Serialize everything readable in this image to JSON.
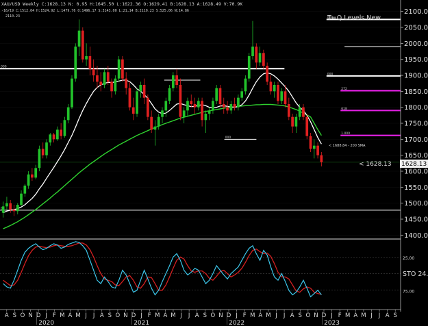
{
  "header": {
    "line1": "XAU/USD Weekly C:1628.13 N: 0.95 H:1645.50 L:1622.36 O:1629.41 B:1628.13 A:1628.49 V:70.9K",
    "line2": "-16/19 C:1512.04 H:1524.92 L:1479.76 O:1496.17 S:3143.00 L:21,14 B:2110.23 S:525.06 N:14.86",
    "line3": "2110.23"
  },
  "title": "T=Q Levels New",
  "colors": {
    "background": "#000000",
    "up": "#22c22b",
    "down": "#e02020",
    "sma200": "#2fd12f",
    "smaFast": "#ffffff",
    "smaSlow": "#bdbdbd",
    "level": "#ffffff",
    "magenta": "#e020e0",
    "stoK": "#3cc6ea",
    "stoD": "#d42020"
  },
  "chart_data": {
    "type": "line",
    "title": "T=Q Levels New",
    "price_axis": {
      "ylim": [
        1390,
        2110
      ],
      "ticks": [
        1400,
        1450,
        1500,
        1550,
        1600,
        1650,
        1700,
        1750,
        1800,
        1850,
        1900,
        1950,
        2000,
        2050,
        2100
      ]
    },
    "current_price": {
      "value": 1628.13,
      "label": "< 1628.13",
      "box": "1628.13"
    },
    "sma_note": "< 1688.84 - 200 SMA",
    "months": [
      "A",
      "S",
      "O",
      "N",
      "D",
      "J",
      "F",
      "M",
      "A",
      "M",
      "J",
      "J",
      "A",
      "S",
      "O",
      "N",
      "D",
      "J",
      "F",
      "M",
      "A",
      "M",
      "J",
      "J",
      "A",
      "S",
      "O",
      "N",
      "D",
      "J",
      "F",
      "M",
      "A",
      "M",
      "J",
      "J",
      "A",
      "S",
      "O",
      "N",
      "D",
      "J",
      "F",
      "M",
      "A",
      "M",
      "J",
      "J",
      "A",
      "S"
    ],
    "years": [
      "2020",
      "2021",
      "2022",
      "2023"
    ],
    "horizontal_levels": [
      {
        "value": 1921,
        "from": 0.0,
        "to": 0.71,
        "color": "level",
        "label": "000"
      },
      {
        "value": 1478,
        "from": 0.0,
        "to": 1.0,
        "color": "level",
        "label": "0"
      },
      {
        "value": 2075,
        "from": 0.815,
        "to": 1.0,
        "color": "level",
        "label": "000"
      },
      {
        "value": 1898,
        "from": 0.815,
        "to": 1.0,
        "color": "level",
        "label": "000"
      },
      {
        "value": 1990,
        "from": 0.86,
        "to": 1.0,
        "color": "level",
        "label": ""
      },
      {
        "value": 1712,
        "from": 0.85,
        "to": 1.0,
        "color": "magenta",
        "label": "1.000"
      },
      {
        "value": 1852,
        "from": 0.85,
        "to": 1.0,
        "color": "magenta",
        "label": "272"
      },
      {
        "value": 1790,
        "from": 0.85,
        "to": 1.0,
        "color": "magenta",
        "label": "618"
      },
      {
        "value": 1885,
        "from": 0.41,
        "to": 0.5,
        "color": "level",
        "label": ""
      },
      {
        "value": 1700,
        "from": 0.56,
        "to": 0.64,
        "color": "level",
        "label": "000"
      }
    ],
    "candles": [
      [
        1470,
        1505,
        1455,
        1490
      ],
      [
        1490,
        1520,
        1480,
        1500
      ],
      [
        1500,
        1510,
        1470,
        1480
      ],
      [
        1480,
        1495,
        1460,
        1475
      ],
      [
        1475,
        1500,
        1465,
        1495
      ],
      [
        1495,
        1540,
        1490,
        1530
      ],
      [
        1530,
        1560,
        1520,
        1555
      ],
      [
        1555,
        1600,
        1545,
        1590
      ],
      [
        1590,
        1610,
        1570,
        1580
      ],
      [
        1580,
        1620,
        1575,
        1610
      ],
      [
        1610,
        1680,
        1600,
        1670
      ],
      [
        1670,
        1690,
        1640,
        1650
      ],
      [
        1650,
        1700,
        1640,
        1690
      ],
      [
        1690,
        1720,
        1680,
        1715
      ],
      [
        1715,
        1720,
        1690,
        1700
      ],
      [
        1700,
        1740,
        1695,
        1730
      ],
      [
        1730,
        1750,
        1700,
        1710
      ],
      [
        1710,
        1770,
        1705,
        1760
      ],
      [
        1760,
        1810,
        1750,
        1800
      ],
      [
        1800,
        1900,
        1795,
        1890
      ],
      [
        1890,
        2000,
        1880,
        1990
      ],
      [
        1990,
        2075,
        1960,
        2040
      ],
      [
        2040,
        2050,
        1940,
        1950
      ],
      [
        1950,
        2000,
        1930,
        1960
      ],
      [
        1960,
        1990,
        1900,
        1920
      ],
      [
        1920,
        1950,
        1880,
        1900
      ],
      [
        1900,
        1930,
        1860,
        1880
      ],
      [
        1880,
        1910,
        1850,
        1870
      ],
      [
        1870,
        1920,
        1860,
        1910
      ],
      [
        1910,
        1930,
        1870,
        1880
      ],
      [
        1880,
        1890,
        1830,
        1850
      ],
      [
        1850,
        1900,
        1840,
        1890
      ],
      [
        1890,
        1960,
        1880,
        1950
      ],
      [
        1950,
        1960,
        1880,
        1890
      ],
      [
        1890,
        1910,
        1840,
        1860
      ],
      [
        1860,
        1880,
        1790,
        1800
      ],
      [
        1800,
        1830,
        1760,
        1780
      ],
      [
        1780,
        1860,
        1770,
        1850
      ],
      [
        1850,
        1880,
        1830,
        1870
      ],
      [
        1870,
        1890,
        1810,
        1830
      ],
      [
        1830,
        1840,
        1760,
        1770
      ],
      [
        1770,
        1790,
        1720,
        1730
      ],
      [
        1730,
        1760,
        1680,
        1740
      ],
      [
        1740,
        1780,
        1730,
        1770
      ],
      [
        1770,
        1800,
        1750,
        1790
      ],
      [
        1790,
        1830,
        1770,
        1820
      ],
      [
        1820,
        1870,
        1810,
        1860
      ],
      [
        1860,
        1910,
        1850,
        1900
      ],
      [
        1900,
        1920,
        1860,
        1870
      ],
      [
        1870,
        1890,
        1760,
        1770
      ],
      [
        1770,
        1800,
        1750,
        1790
      ],
      [
        1790,
        1830,
        1770,
        1820
      ],
      [
        1820,
        1840,
        1800,
        1810
      ],
      [
        1810,
        1830,
        1780,
        1800
      ],
      [
        1800,
        1830,
        1790,
        1820
      ],
      [
        1820,
        1830,
        1740,
        1760
      ],
      [
        1760,
        1790,
        1720,
        1780
      ],
      [
        1780,
        1800,
        1760,
        1790
      ],
      [
        1790,
        1830,
        1780,
        1820
      ],
      [
        1820,
        1870,
        1810,
        1860
      ],
      [
        1860,
        1870,
        1800,
        1810
      ],
      [
        1810,
        1830,
        1780,
        1800
      ],
      [
        1800,
        1820,
        1780,
        1790
      ],
      [
        1790,
        1820,
        1780,
        1810
      ],
      [
        1810,
        1830,
        1790,
        1800
      ],
      [
        1800,
        1840,
        1790,
        1830
      ],
      [
        1830,
        1860,
        1820,
        1850
      ],
      [
        1850,
        1900,
        1840,
        1890
      ],
      [
        1890,
        1970,
        1880,
        1960
      ],
      [
        1960,
        2070,
        1950,
        1990
      ],
      [
        1990,
        2000,
        1920,
        1940
      ],
      [
        1940,
        1990,
        1930,
        1970
      ],
      [
        1970,
        1980,
        1920,
        1930
      ],
      [
        1930,
        1940,
        1870,
        1880
      ],
      [
        1880,
        1900,
        1840,
        1850
      ],
      [
        1850,
        1880,
        1830,
        1870
      ],
      [
        1870,
        1880,
        1810,
        1820
      ],
      [
        1820,
        1860,
        1810,
        1850
      ],
      [
        1850,
        1870,
        1800,
        1810
      ],
      [
        1810,
        1830,
        1760,
        1770
      ],
      [
        1770,
        1780,
        1720,
        1740
      ],
      [
        1740,
        1780,
        1720,
        1770
      ],
      [
        1770,
        1810,
        1760,
        1800
      ],
      [
        1800,
        1810,
        1760,
        1770
      ],
      [
        1770,
        1780,
        1700,
        1710
      ],
      [
        1710,
        1720,
        1660,
        1670
      ],
      [
        1670,
        1700,
        1640,
        1680
      ],
      [
        1680,
        1690,
        1640,
        1650
      ],
      [
        1650,
        1660,
        1615,
        1628
      ]
    ],
    "sma200": [
      1420,
      1425,
      1430,
      1436,
      1442,
      1449,
      1456,
      1464,
      1472,
      1480,
      1489,
      1498,
      1507,
      1516,
      1526,
      1535,
      1545,
      1555,
      1565,
      1575,
      1585,
      1595,
      1604,
      1613,
      1622,
      1630,
      1638,
      1646,
      1654,
      1661,
      1668,
      1675,
      1682,
      1688,
      1694,
      1700,
      1706,
      1712,
      1717,
      1722,
      1727,
      1732,
      1737,
      1741,
      1746,
      1750,
      1754,
      1758,
      1762,
      1766,
      1769,
      1772,
      1775,
      1778,
      1781,
      1784,
      1787,
      1789,
      1791,
      1793,
      1795,
      1797,
      1799,
      1800,
      1802,
      1803,
      1804,
      1805,
      1806,
      1807,
      1808,
      1808,
      1809,
      1809,
      1809,
      1808,
      1807,
      1806,
      1804,
      1801,
      1797,
      1793,
      1788,
      1782,
      1776,
      1770,
      1750,
      1730,
      1712
    ],
    "smaFast": [
      1470,
      1475,
      1478,
      1480,
      1483,
      1488,
      1495,
      1505,
      1515,
      1528,
      1545,
      1560,
      1578,
      1595,
      1612,
      1630,
      1648,
      1668,
      1690,
      1712,
      1738,
      1765,
      1790,
      1812,
      1832,
      1850,
      1862,
      1870,
      1875,
      1878,
      1878,
      1879,
      1882,
      1885,
      1885,
      1880,
      1870,
      1858,
      1850,
      1840,
      1828,
      1812,
      1795,
      1785,
      1780,
      1782,
      1790,
      1800,
      1810,
      1812,
      1808,
      1805,
      1802,
      1803,
      1806,
      1808,
      1805,
      1800,
      1798,
      1800,
      1804,
      1805,
      1803,
      1801,
      1800,
      1802,
      1808,
      1820,
      1838,
      1860,
      1880,
      1895,
      1905,
      1908,
      1905,
      1898,
      1888,
      1876,
      1864,
      1850,
      1832,
      1814,
      1800,
      1790,
      1775,
      1755,
      1730,
      1705,
      1685
    ],
    "stoK": [
      35,
      30,
      28,
      40,
      55,
      70,
      82,
      88,
      92,
      95,
      90,
      86,
      88,
      92,
      95,
      93,
      88,
      90,
      94,
      96,
      98,
      97,
      92,
      85,
      70,
      55,
      40,
      35,
      45,
      38,
      30,
      28,
      40,
      55,
      48,
      35,
      22,
      25,
      40,
      55,
      42,
      28,
      18,
      25,
      38,
      50,
      62,
      75,
      80,
      70,
      55,
      48,
      52,
      58,
      55,
      45,
      35,
      40,
      50,
      62,
      55,
      48,
      42,
      50,
      55,
      60,
      70,
      80,
      88,
      92,
      80,
      70,
      85,
      78,
      60,
      45,
      40,
      50,
      38,
      25,
      18,
      22,
      30,
      40,
      28,
      15,
      20,
      25,
      18
    ],
    "stoD": [
      40,
      36,
      32,
      33,
      40,
      52,
      65,
      77,
      85,
      90,
      91,
      90,
      89,
      90,
      92,
      93,
      92,
      91,
      91,
      92,
      94,
      96,
      96,
      93,
      86,
      75,
      62,
      50,
      42,
      40,
      38,
      33,
      32,
      38,
      45,
      47,
      40,
      30,
      28,
      35,
      45,
      44,
      35,
      25,
      25,
      33,
      45,
      58,
      70,
      75,
      72,
      62,
      54,
      52,
      54,
      54,
      50,
      43,
      40,
      46,
      53,
      55,
      50,
      45,
      48,
      52,
      58,
      67,
      77,
      85,
      87,
      83,
      80,
      81,
      76,
      65,
      52,
      45,
      45,
      42,
      33,
      24,
      22,
      27,
      30,
      28,
      22,
      20,
      19
    ],
    "sto_axis": {
      "ticks": [
        "25.00",
        "STO 24.",
        "75.00"
      ]
    }
  }
}
